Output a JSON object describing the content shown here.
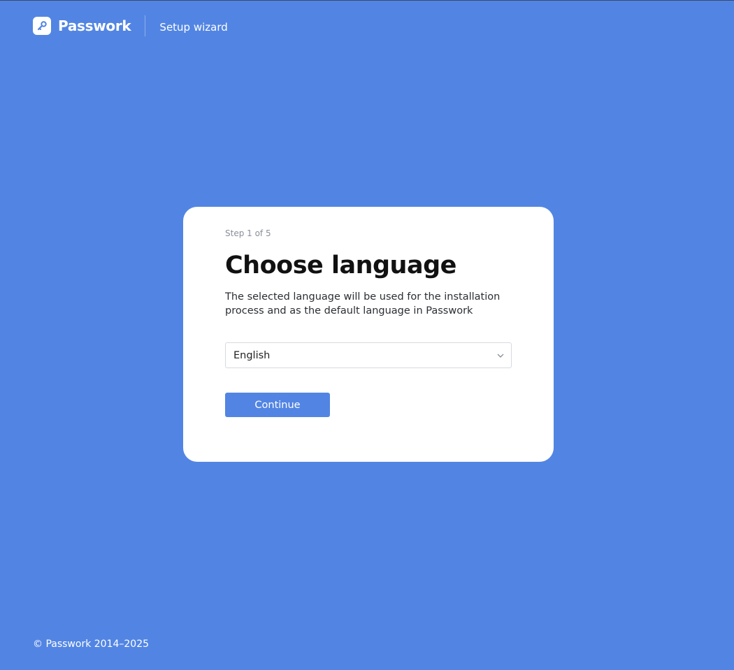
{
  "header": {
    "logo_text": "Passwork",
    "subtitle": "Setup wizard",
    "logo_icon": "key-icon"
  },
  "card": {
    "step": "Step 1 of 5",
    "title": "Choose language",
    "description": "The selected language will be used for the installation process and as the default language in Passwork",
    "language_select": {
      "value": "English",
      "icon": "chevron-down-icon"
    },
    "continue_label": "Continue"
  },
  "footer": {
    "copyright": "© Passwork 2014–2025"
  },
  "colors": {
    "background": "#5285e3",
    "card": "#ffffff",
    "button": "#5285e3"
  }
}
